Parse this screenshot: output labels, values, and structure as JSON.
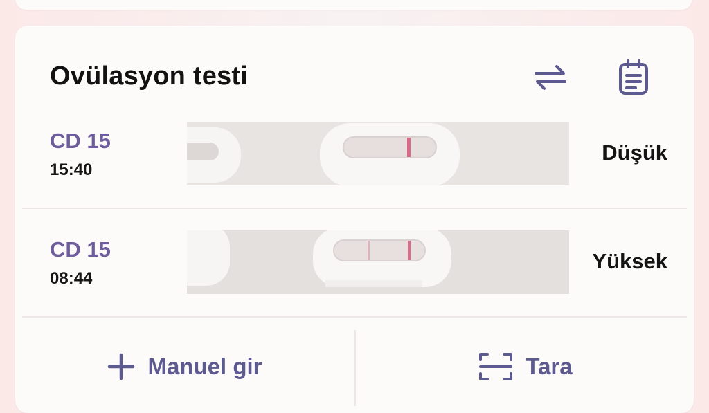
{
  "card": {
    "title": "Ovülasyon testi",
    "icons": [
      "swap-arrows-icon",
      "clipboard-icon"
    ],
    "accent_color": "#6e5d9d",
    "icon_color": "#5c5a8e"
  },
  "entries": [
    {
      "cycle_day": "CD 15",
      "time": "15:40",
      "result": "Düşük"
    },
    {
      "cycle_day": "CD 15",
      "time": "08:44",
      "result": "Yüksek"
    }
  ],
  "actions": {
    "manual_label": "Manuel gir",
    "scan_label": "Tara"
  }
}
